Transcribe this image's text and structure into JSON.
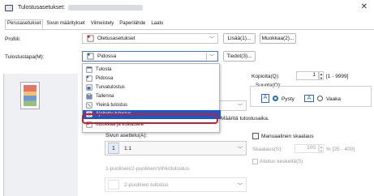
{
  "window": {
    "title": "Tulostusasetukset:"
  },
  "tabs": [
    "Perusasetukset",
    "Sivun määritykset",
    "Viimeistely",
    "Paperilähde",
    "Laatu"
  ],
  "profile": {
    "label": "Profiili:",
    "value": "Oletusasetukset",
    "add_button": "Lisää(1)...",
    "edit_button": "Muokkaa(2)..."
  },
  "output_method": {
    "label": "Tulostustapa(M):",
    "value": "Pidossa",
    "details_button": "Tiedot(3)..."
  },
  "dropdown": {
    "items": [
      "Tulosta",
      "Pidossa",
      "Turvatulostus",
      "Tallenna",
      "Yleinä tulostus",
      "Ajoitettu tulostus",
      "Muokkaa ja esikatsele"
    ],
    "selected_index": 5
  },
  "copies": {
    "label": "Kopioita(Q):",
    "value": "1",
    "range": "[1 - 9999]"
  },
  "orientation": {
    "label": "Suunta(O):",
    "portrait": "Pysty",
    "landscape": "Vaaka",
    "portrait_letter": "A",
    "landscape_letter": "A"
  },
  "hint_text": "Määritä tulostusaika.",
  "page_size": {
    "label": "Sivun asettelu(A):",
    "value": "1:1",
    "number": "1"
  },
  "manual_scale": {
    "label": "Manuaalinen skaalaus",
    "scale_label": "Skaalaus(S):",
    "value": "100",
    "range": "% [25 - 400]"
  },
  "poster_center": {
    "label": "Aloitus keskeltä(5)"
  },
  "duplex": {
    "label": "1-puolinen/2-puolinen/Vihkotulostus:",
    "value": "2-puolinen tulostus"
  }
}
